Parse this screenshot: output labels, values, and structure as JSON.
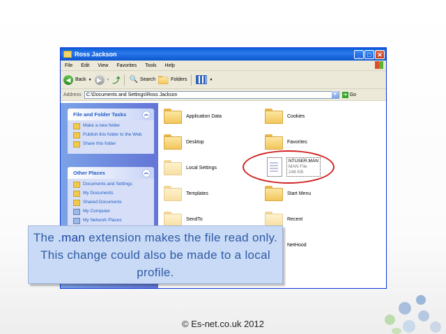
{
  "window": {
    "title": "Ross Jackson",
    "menu": [
      "File",
      "Edit",
      "View",
      "Favorites",
      "Tools",
      "Help"
    ],
    "toolbar": {
      "back": "Back",
      "search": "Search",
      "folders": "Folders"
    },
    "address": {
      "label": "Address",
      "value": "C:\\Documents and Settings\\Ross Jackson",
      "go": "Go"
    }
  },
  "sidebar": {
    "file_folder_tasks": {
      "header": "File and Folder Tasks",
      "items": [
        "Make a new folder",
        "Publish this folder to the Web",
        "Share this folder"
      ]
    },
    "other_places": {
      "header": "Other Places",
      "items": [
        "Documents and Settings",
        "My Documents",
        "Shared Documents",
        "My Computer",
        "My Network Places"
      ]
    }
  },
  "content": {
    "left_column": [
      "Application Data",
      "Desktop",
      "Local Settings",
      "Templates",
      "SendTo"
    ],
    "right_column": [
      "Cookies",
      "Favorites",
      "Start Menu",
      "Recent",
      "NetHood"
    ],
    "file": {
      "name": "NTUSER.MAN",
      "type": "MAN File",
      "size": "248 KB"
    }
  },
  "callout": {
    "part1": "The ",
    "ext": ".man",
    "part2": " extension makes the file read only. This change could also be made to a local profile."
  },
  "footer": "© Es-net.co.uk 2012",
  "colors": {
    "accent_red": "#d01f1f",
    "callout_bg": "#c8daf5",
    "callout_text": "#2e5aa6"
  }
}
